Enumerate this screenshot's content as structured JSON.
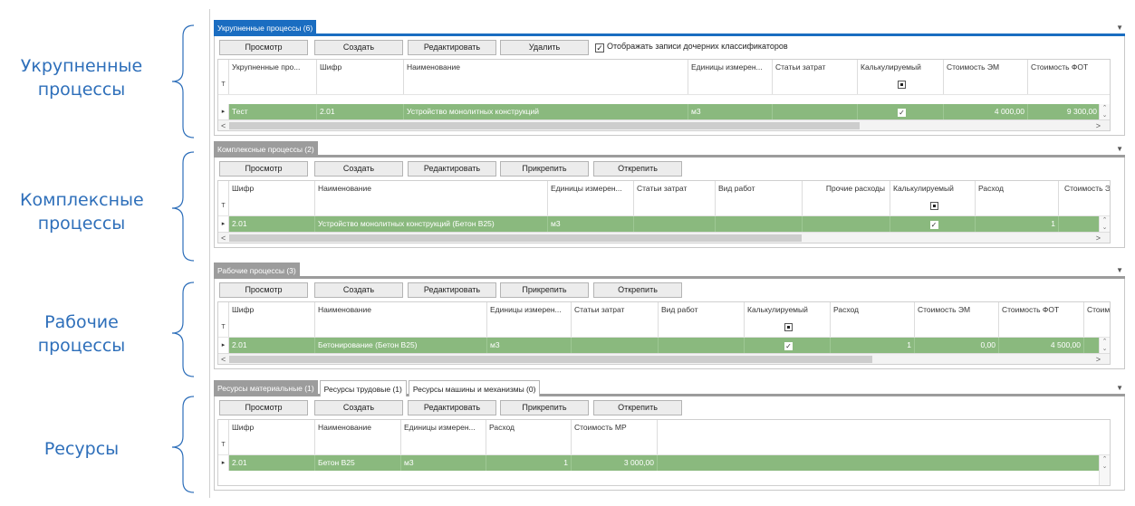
{
  "labels": {
    "l1": "Укрупненные процессы",
    "l2": "Комплексные процессы",
    "l3": "Рабочие процессы",
    "l4": "Ресурсы"
  },
  "p1": {
    "tab": "Укрупненные процессы (6)",
    "buttons": [
      "Просмотр",
      "Создать",
      "Редактировать",
      "Удалить"
    ],
    "checkbox_label": "Отображать записи дочерних классификаторов",
    "checkbox_checked": true,
    "columns": [
      "Укрупненные про...",
      "Шифр",
      "Наименование",
      "Единицы измерен...",
      "Статьи затрат",
      "Калькулируемый",
      "Стоимость ЭМ",
      "Стоимость ФОТ"
    ],
    "row": [
      "Тест",
      "2.01",
      "Устройство монолитных конструкций",
      "м3",
      "",
      "✓",
      "4 000,00",
      "9 300,00"
    ]
  },
  "p2": {
    "tab": "Комплексные процессы (2)",
    "buttons": [
      "Просмотр",
      "Создать",
      "Редактировать",
      "Прикрепить",
      "Открепить"
    ],
    "columns": [
      "Шифр",
      "Наименование",
      "Единицы измерен...",
      "Статьи затрат",
      "Вид работ",
      "Прочие расходы",
      "Калькулируемый",
      "Расход",
      "Стоимость Э"
    ],
    "row": [
      "2.01",
      "Устройство монолитных конструкций (Бетон В25)",
      "м3",
      "",
      "",
      "",
      "✓",
      "1",
      ""
    ]
  },
  "p3": {
    "tab": "Рабочие процессы (3)",
    "buttons": [
      "Просмотр",
      "Создать",
      "Редактировать",
      "Прикрепить",
      "Открепить"
    ],
    "columns": [
      "Шифр",
      "Наименование",
      "Единицы измерен...",
      "Статьи затрат",
      "Вид работ",
      "Калькулируемый",
      "Расход",
      "Стоимость ЭМ",
      "Стоимость ФОТ",
      "Стоим"
    ],
    "row": [
      "2.01",
      "Бетонирование (Бетон В25)",
      "м3",
      "",
      "",
      "✓",
      "1",
      "0,00",
      "4 500,00",
      ""
    ]
  },
  "p4": {
    "tabs": [
      "Ресурсы материальные (1)",
      "Ресурсы трудовые (1)",
      "Ресурсы машины и механизмы (0)"
    ],
    "buttons": [
      "Просмотр",
      "Создать",
      "Редактировать",
      "Прикрепить",
      "Открепить"
    ],
    "columns": [
      "Шифр",
      "Наименование",
      "Единицы измерен...",
      "Расход",
      "Стоимость МР"
    ],
    "row": [
      "2.01",
      "Бетон В25",
      "м3",
      "1",
      "3 000,00"
    ]
  },
  "colors": {
    "accent": "#1a6dc1",
    "row_green": "#8ab97e",
    "label_blue": "#2e6fba"
  },
  "icons": {
    "brace": "brace-icon",
    "filter": "filter-icon",
    "row_pointer": "row-pointer-icon",
    "dropdown": "chevron-down-icon"
  }
}
